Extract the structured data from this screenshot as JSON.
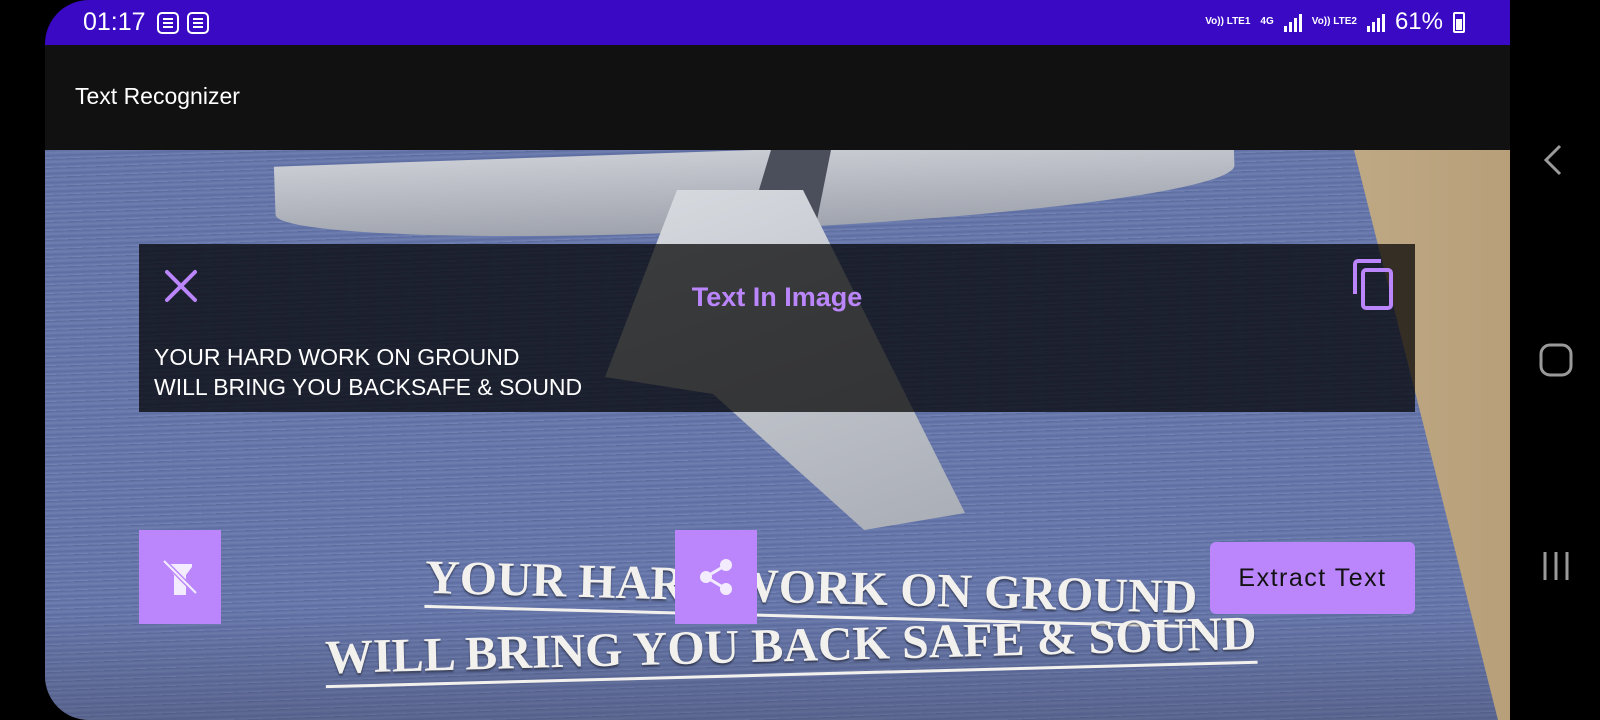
{
  "status_bar": {
    "time": "01:17",
    "network_1": "Vo)) LTE1",
    "network_4g": "4G",
    "network_2": "Vo)) LTE2",
    "battery": "61%"
  },
  "app_bar": {
    "title": "Text Recognizer"
  },
  "camera": {
    "poster_line1": "YOUR HARD WORK ON GROUND",
    "poster_line2": "WILL BRING YOU BACK SAFE & SOUND"
  },
  "result_panel": {
    "title": "Text In Image",
    "text": "YOUR HARD WORK ON GROUND\nWILL BRING YOU BACKSAFE & SOUND",
    "close_icon": "close-icon",
    "copy_icon": "copy-icon"
  },
  "actions": {
    "torch_icon": "flashlight-off-icon",
    "share_icon": "share-icon",
    "extract_label": "Extract Text"
  },
  "colors": {
    "status_bar": "#3a09c4",
    "accent": "#bb86fc",
    "app_bar": "#111111"
  }
}
